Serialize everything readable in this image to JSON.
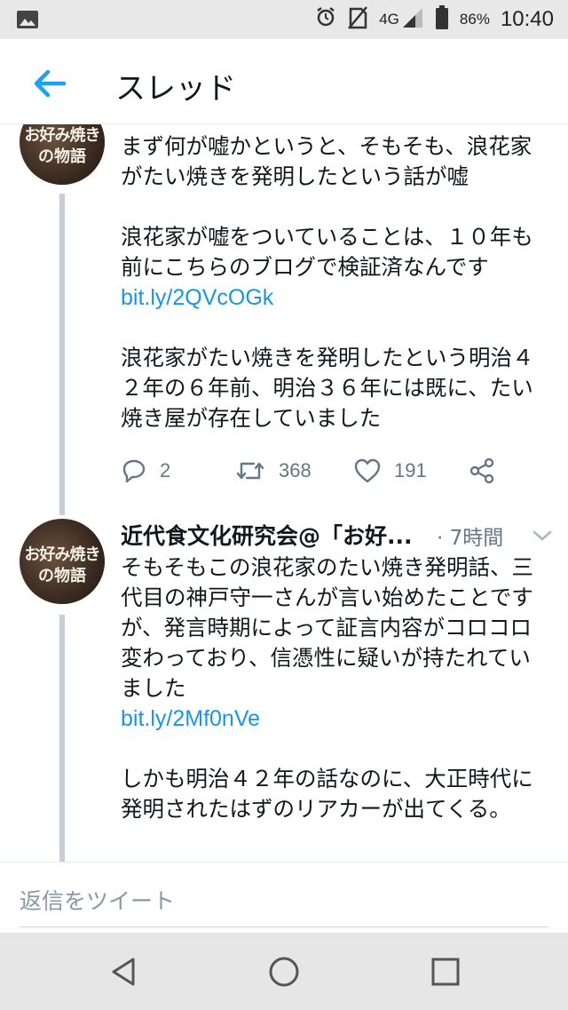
{
  "status_bar": {
    "battery": "86%",
    "time": "10:40",
    "network": "4G",
    "icons": [
      "image-icon",
      "alarm-icon",
      "no-sim-icon",
      "signal-icon",
      "battery-icon"
    ]
  },
  "header": {
    "back_icon": "back-arrow-icon",
    "title": "スレッド"
  },
  "tweet1": {
    "paragraphs": [
      "まず何が嘘かというと、そもそも、浪花家がたい焼きを発明したという話が嘘",
      "浪花家が嘘をついていることは、１０年も前にこちらのブログで検証済なんです",
      "浪花家がたい焼きを発明したという明治４２年の６年前、明治３６年には既に、たい焼き屋が存在していました"
    ],
    "link": "bit.ly/2QVcOGk",
    "actions": {
      "reply_count": "2",
      "retweet_count": "368",
      "like_count": "191"
    }
  },
  "tweet2": {
    "name": "近代食文化研究会@「お好...",
    "time": "· 7時間",
    "paragraph1": "そもそもこの浪花家のたい焼き発明話、三代目の神戸守一さんが言い始めたことですが、発言時期によって証言内容がコロコロ変わっており、信憑性に疑いが持たれていました",
    "link": "bit.ly/2Mf0nVe",
    "paragraph2": "しかも明治４２年の話なのに、大正時代に発明されたはずのリアカーが出てくる。"
  },
  "avatar": {
    "line1": "お好み焼き",
    "line2": "の物語",
    "colors": {
      "dark": "#3a2a20",
      "text": "#f4efe6"
    }
  },
  "reply": {
    "placeholder": "返信をツイート"
  },
  "colors": {
    "link": "#1b95e0",
    "accent": "#1da1f2",
    "muted": "#657786",
    "thread_line": "#c4cfd6"
  }
}
